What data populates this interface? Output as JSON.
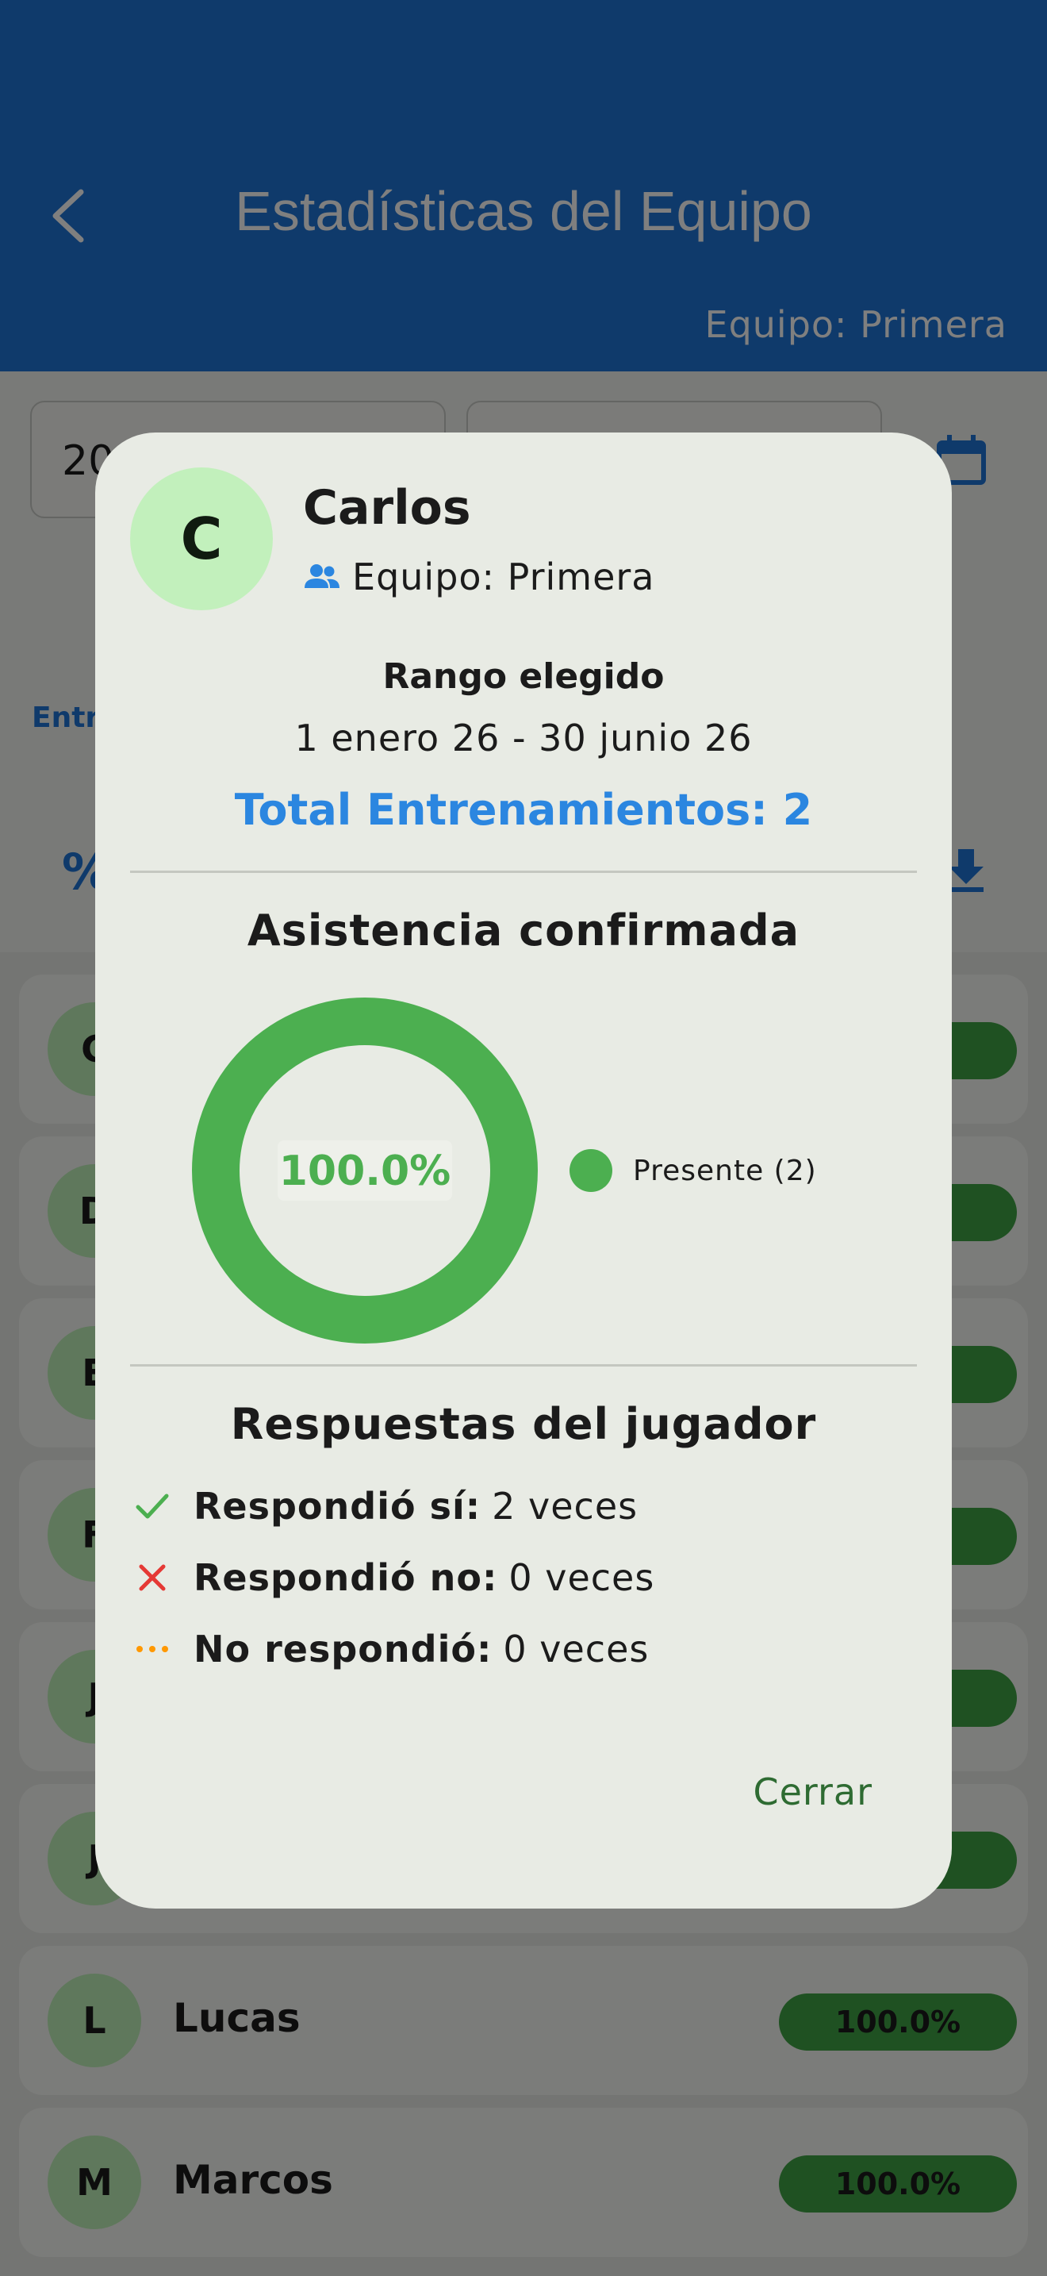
{
  "appbar": {
    "title": "Estadísticas del Equipo",
    "subtitle": "Equipo: Primera"
  },
  "filters": {
    "start_date_partial": "20",
    "link_partial": "Entr"
  },
  "players": [
    {
      "initial": "C",
      "name": "",
      "percent": ""
    },
    {
      "initial": "D",
      "name": "",
      "percent": ""
    },
    {
      "initial": "E",
      "name": "",
      "percent": ""
    },
    {
      "initial": "F",
      "name": "",
      "percent": ""
    },
    {
      "initial": "J",
      "name": "",
      "percent": ""
    },
    {
      "initial": "J",
      "name": "",
      "percent": ""
    },
    {
      "initial": "L",
      "name": "Lucas",
      "percent": "100.0%"
    },
    {
      "initial": "M",
      "name": "Marcos",
      "percent": "100.0%"
    }
  ],
  "dialog": {
    "avatar_initial": "C",
    "player_name": "Carlos",
    "team_label": "Equipo: Primera",
    "range_label": "Rango elegido",
    "range_value": "1 enero 26 - 30 junio 26",
    "total_label": "Total Entrenamientos: 2",
    "attendance_title": "Asistencia confirmada",
    "attendance_percent_label": "100.0%",
    "legend_label": "Presente (2)",
    "responses_title": "Respuestas del jugador",
    "responses": [
      {
        "icon": "check-icon",
        "label": "Respondió sí:",
        "value": "2 veces",
        "color": "#4caf50"
      },
      {
        "icon": "close-icon",
        "label": "Respondió no:",
        "value": "0 veces",
        "color": "#e53935"
      },
      {
        "icon": "more-horiz-icon",
        "label": "No respondió:",
        "value": "0 veces",
        "color": "#ff9800"
      }
    ],
    "close_label": "Cerrar"
  },
  "chart_data": {
    "type": "pie",
    "categories": [
      "Presente"
    ],
    "values": [
      2
    ],
    "percent_present": 100.0,
    "colors": {
      "present": "#4caf50"
    }
  },
  "colors": {
    "primary": "#1f74d6",
    "accent_green": "#4caf50",
    "total_blue": "#2b86e0",
    "close_green": "#2e6b32"
  }
}
